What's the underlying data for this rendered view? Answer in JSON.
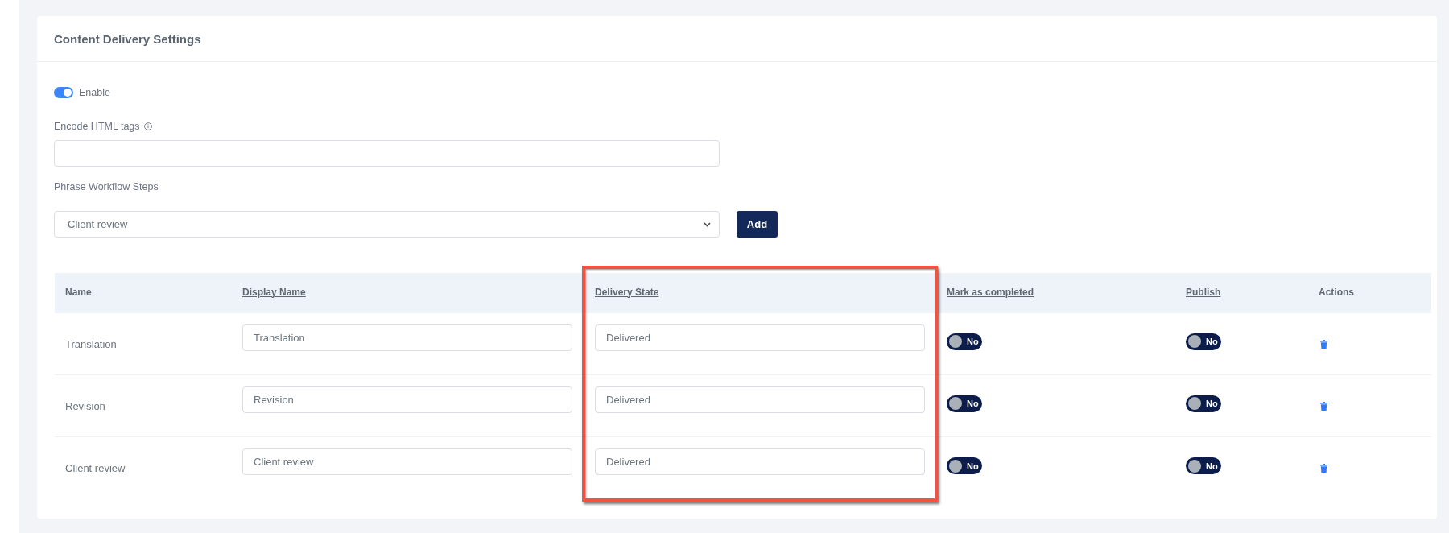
{
  "card": {
    "title": "Content Delivery Settings"
  },
  "enable": {
    "label": "Enable",
    "on": true
  },
  "encode_html_tags": {
    "label": "Encode HTML tags"
  },
  "workflow_steps": {
    "label": "Phrase Workflow Steps",
    "selected_step": "Client review",
    "add_button": "Add"
  },
  "table": {
    "columns": [
      {
        "label": "Name",
        "sortable": false,
        "highlighted": false
      },
      {
        "label": "Display Name",
        "sortable": true,
        "highlighted": false
      },
      {
        "label": "Delivery State",
        "sortable": true,
        "highlighted": true
      },
      {
        "label": "Mark as completed",
        "sortable": true,
        "highlighted": false
      },
      {
        "label": "Publish",
        "sortable": true,
        "highlighted": false
      },
      {
        "label": "Actions",
        "sortable": false,
        "highlighted": false
      }
    ],
    "rows": [
      {
        "name": "Translation",
        "display_name": "Translation",
        "delivery_state": "Delivered",
        "mark_as_completed": {
          "label": "No",
          "on": false
        },
        "publish": {
          "label": "No",
          "on": false
        }
      },
      {
        "name": "Revision",
        "display_name": "Revision",
        "delivery_state": "Delivered",
        "mark_as_completed": {
          "label": "No",
          "on": false
        },
        "publish": {
          "label": "No",
          "on": false
        }
      },
      {
        "name": "Client review",
        "display_name": "Client review",
        "delivery_state": "Delivered",
        "mark_as_completed": {
          "label": "No",
          "on": false
        },
        "publish": {
          "label": "No",
          "on": false
        }
      }
    ]
  }
}
